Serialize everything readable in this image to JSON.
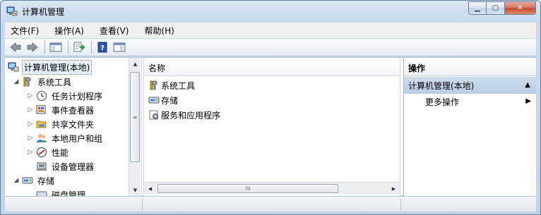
{
  "window": {
    "title": "计算机管理",
    "title_icon": "computer-management-icon",
    "minimize_glyph": "▁",
    "maximize_glyph": "▢",
    "close_glyph": "✕"
  },
  "menubar": {
    "items": [
      "文件(F)",
      "操作(A)",
      "查看(V)",
      "帮助(H)"
    ]
  },
  "toolbar": {
    "icons": [
      "back-arrow-icon",
      "forward-arrow-icon",
      "show-hide-console-tree-icon",
      "export-list-icon",
      "help-icon",
      "show-hide-action-pane-icon"
    ]
  },
  "tree": {
    "root": {
      "label": "计算机管理(本地)",
      "icon": "computer-management-icon"
    },
    "system_tools": {
      "label": "系统工具",
      "expander": "◢",
      "icon": "tools-icon"
    },
    "children": [
      {
        "label": "任务计划程序",
        "expander": "▷",
        "icon": "clock-icon"
      },
      {
        "label": "事件查看器",
        "expander": "▷",
        "icon": "event-viewer-icon"
      },
      {
        "label": "共享文件夹",
        "expander": "▷",
        "icon": "shared-folder-icon"
      },
      {
        "label": "本地用户和组",
        "expander": "▷",
        "icon": "users-icon"
      },
      {
        "label": "性能",
        "expander": "▷",
        "icon": "performance-icon"
      },
      {
        "label": "设备管理器",
        "expander": "",
        "icon": "device-manager-icon"
      }
    ],
    "storage": {
      "label": "存储",
      "expander": "◢",
      "icon": "storage-icon"
    },
    "partial_child": {
      "label": "磁盘管理",
      "icon": "disk-icon"
    }
  },
  "scroll": {
    "up_glyph": "▲",
    "down_glyph": "▼",
    "left_glyph": "◀",
    "right_glyph": "▶",
    "grip_vertical": "≡",
    "grip_horizontal": "III"
  },
  "list": {
    "header": "名称",
    "rows": [
      {
        "label": "系统工具",
        "icon": "tools-icon"
      },
      {
        "label": "存储",
        "icon": "storage-icon"
      },
      {
        "label": "服务和应用程序",
        "icon": "services-icon"
      }
    ]
  },
  "actions": {
    "header": "操作",
    "group_label": "计算机管理(本地)",
    "group_glyph": "▲",
    "more_label": "更多操作",
    "more_glyph": "▶"
  },
  "colors": {
    "action_group_bg": "#c4d5ec",
    "title_bar": "#d3e2f4",
    "close_button": "#c9553c"
  }
}
